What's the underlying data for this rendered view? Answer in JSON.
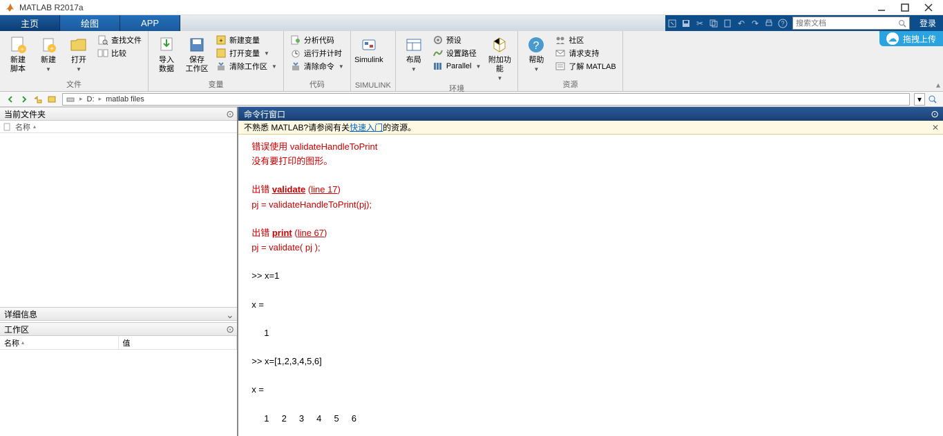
{
  "titlebar": {
    "title": "MATLAB R2017a"
  },
  "tabs": {
    "home": "主页",
    "plots": "绘图",
    "apps": "APP"
  },
  "topright": {
    "search_placeholder": "搜索文档",
    "login": "登录",
    "upload": "拖拽上传"
  },
  "ribbon": {
    "g_file": {
      "label": "文件",
      "new_script": "新建\n脚本",
      "new": "新建",
      "open": "打开",
      "find_files": "查找文件",
      "compare": "比较"
    },
    "g_var": {
      "label": "变量",
      "import": "导入\n数据",
      "save_ws": "保存\n工作区",
      "new_var": "新建变量",
      "open_var": "打开变量",
      "clear_ws": "清除工作区"
    },
    "g_code": {
      "label": "代码",
      "analyze": "分析代码",
      "timeit": "运行并计时",
      "clear_cmd": "清除命令"
    },
    "g_simulink": {
      "label": "SIMULINK",
      "simulink": "Simulink"
    },
    "g_env": {
      "label": "环境",
      "layout": "布局",
      "prefs": "预设",
      "setpath": "设置路径",
      "parallel": "Parallel",
      "addons": "附加功能"
    },
    "g_res": {
      "label": "资源",
      "help": "帮助",
      "community": "社区",
      "support": "请求支持",
      "learn": "了解 MATLAB"
    }
  },
  "path": {
    "drive": "D:",
    "folder": "matlab files"
  },
  "panels": {
    "current_folder": "当前文件夹",
    "folder_col_name": "名称",
    "detail": "详细信息",
    "workspace": "工作区",
    "ws_name": "名称",
    "ws_value": "值"
  },
  "cmd": {
    "title": "命令行窗口",
    "banner_pre": "不熟悉 MATLAB?请参阅有关",
    "banner_link": "快速入门",
    "banner_post": "的资源。",
    "l1": "  错误使用 validateHandleToPrint",
    "l2": "  没有要打印的图形。",
    "l3a": "  出错 ",
    "l3b": "validate",
    "l3c": " (",
    "l3d": "line 17",
    "l3e": ")",
    "l4": "  pj = validateHandleToPrint(pj);",
    "l5a": "  出错 ",
    "l5b": "print",
    "l5c": " (",
    "l5d": "line 67",
    "l5e": ")",
    "l6": "  pj = validate( pj );",
    "l7": "  >> x=1",
    "l8": "  x =",
    "l9": "       1",
    "l10": "  >> x=[1,2,3,4,5,6]",
    "l11": "  x =",
    "l12": "       1     2     3     4     5     6"
  }
}
